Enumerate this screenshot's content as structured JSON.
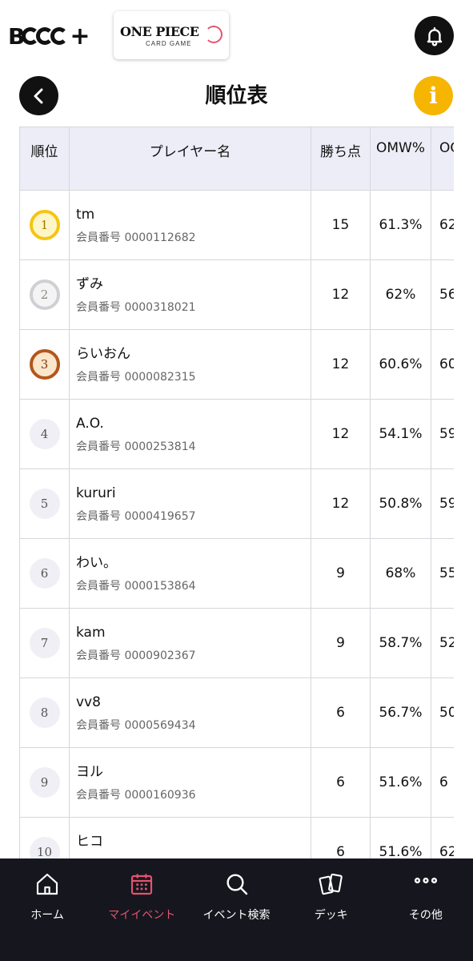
{
  "header": {
    "brand_logo_text": "B",
    "brand_plus": "+",
    "partner_logo_title": "ONE PIECE",
    "partner_logo_subtitle": "CARD GAME",
    "page_title": "順位表",
    "info_label": "i"
  },
  "table": {
    "columns": {
      "rank": "順位",
      "player": "プレイヤー名",
      "points": "勝ち点",
      "omw": "OMW%",
      "oomw": "OO"
    },
    "member_prefix": "会員番号",
    "rows": [
      {
        "rank": "1",
        "name": "tm",
        "member_no": "会員番号 0000112682",
        "points": "15",
        "omw": "61.3%",
        "oomw": "62",
        "medal": "gold"
      },
      {
        "rank": "2",
        "name": "ずみ",
        "member_no": "会員番号 0000318021",
        "points": "12",
        "omw": "62%",
        "oomw": "56",
        "medal": "silver"
      },
      {
        "rank": "3",
        "name": "らいおん",
        "member_no": "会員番号 0000082315",
        "points": "12",
        "omw": "60.6%",
        "oomw": "60",
        "medal": "bronze"
      },
      {
        "rank": "4",
        "name": "A.O.",
        "member_no": "会員番号 0000253814",
        "points": "12",
        "omw": "54.1%",
        "oomw": "59",
        "medal": "none"
      },
      {
        "rank": "5",
        "name": "kururi",
        "member_no": "会員番号 0000419657",
        "points": "12",
        "omw": "50.8%",
        "oomw": "59",
        "medal": "none"
      },
      {
        "rank": "6",
        "name": "わい。",
        "member_no": "会員番号 0000153864",
        "points": "9",
        "omw": "68%",
        "oomw": "55",
        "medal": "none"
      },
      {
        "rank": "7",
        "name": "kam",
        "member_no": "会員番号 0000902367",
        "points": "9",
        "omw": "58.7%",
        "oomw": "52",
        "medal": "none"
      },
      {
        "rank": "8",
        "name": "vv8",
        "member_no": "会員番号 0000569434",
        "points": "6",
        "omw": "56.7%",
        "oomw": "50",
        "medal": "none"
      },
      {
        "rank": "9",
        "name": "ヨル",
        "member_no": "会員番号 0000160936",
        "points": "6",
        "omw": "51.6%",
        "oomw": "6",
        "medal": "none"
      },
      {
        "rank": "10",
        "name": "ヒコ",
        "member_no": "",
        "points": "6",
        "omw": "51.6%",
        "oomw": "62",
        "medal": "none"
      }
    ]
  },
  "bottom_nav": {
    "items": [
      {
        "label": "ホーム",
        "icon": "home-icon",
        "active": false
      },
      {
        "label": "マイイベント",
        "icon": "calendar-icon",
        "active": true
      },
      {
        "label": "イベント検索",
        "icon": "search-icon",
        "active": false
      },
      {
        "label": "デッキ",
        "icon": "cards-icon",
        "active": false
      },
      {
        "label": "その他",
        "icon": "more-icon",
        "active": false
      }
    ]
  },
  "colors": {
    "accent": "#e4546d",
    "info": "#f6b500",
    "nav_background": "#16161e",
    "header_cell": "#ededf7",
    "gold": "#f5c512",
    "silver": "#cfcfd4",
    "bronze": "#b3561c"
  }
}
